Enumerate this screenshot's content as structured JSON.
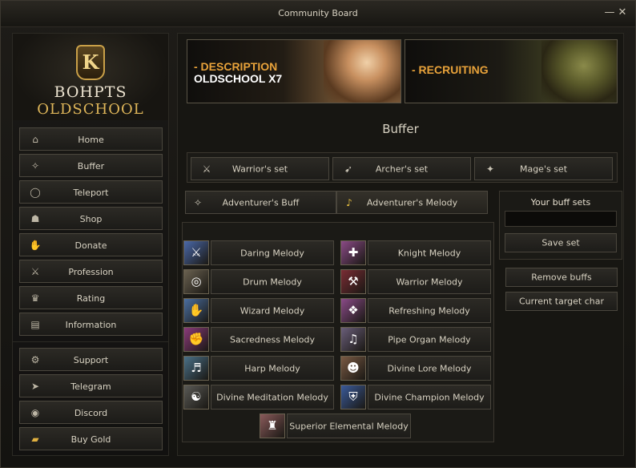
{
  "window": {
    "title": "Community Board",
    "minimize_glyph": "—",
    "close_glyph": "✕"
  },
  "logo": {
    "line1": "BOHPTS",
    "line2": "OLDSCHOOL",
    "mark": "K"
  },
  "sidebar": {
    "items": [
      {
        "label": "Home",
        "icon": "⌂"
      },
      {
        "label": "Buffer",
        "icon": "✧"
      },
      {
        "label": "Teleport",
        "icon": "◯"
      },
      {
        "label": "Shop",
        "icon": "☗"
      },
      {
        "label": "Donate",
        "icon": "✋"
      },
      {
        "label": "Profession",
        "icon": "⚔"
      },
      {
        "label": "Rating",
        "icon": "♛"
      },
      {
        "label": "Information",
        "icon": "▤"
      }
    ],
    "links": [
      {
        "label": "Support",
        "icon": "⚙"
      },
      {
        "label": "Telegram",
        "icon": "➤"
      },
      {
        "label": "Discord",
        "icon": "◉"
      },
      {
        "label": "Buy Gold",
        "icon": "▰"
      }
    ]
  },
  "banners": [
    {
      "accent": "- DESCRIPTION",
      "line2": "OLDSCHOOL X7"
    },
    {
      "accent": "- RECRUITING",
      "line2": ""
    }
  ],
  "section_title": "Buffer",
  "sets": [
    {
      "label": "Warrior's set",
      "icon": "⚔"
    },
    {
      "label": "Archer's set",
      "icon": "➹"
    },
    {
      "label": "Mage's set",
      "icon": "✦"
    }
  ],
  "buff_tabs": [
    {
      "label": "Adventurer's Buff",
      "icon": "✧"
    },
    {
      "label": "Adventurer's Melody",
      "icon": "♪"
    }
  ],
  "melodies": [
    {
      "label": "Daring Melody",
      "glyph": "⚔",
      "color": "#4a68a8"
    },
    {
      "label": "Knight Melody",
      "glyph": "✚",
      "color": "#8a4a86"
    },
    {
      "label": "Drum Melody",
      "glyph": "◎",
      "color": "#6a6150"
    },
    {
      "label": "Warrior Melody",
      "glyph": "⚒",
      "color": "#7a2c34"
    },
    {
      "label": "Wizard Melody",
      "glyph": "✋",
      "color": "#4a6ea0"
    },
    {
      "label": "Refreshing Melody",
      "glyph": "❖",
      "color": "#8a4a88"
    },
    {
      "label": "Sacredness Melody",
      "glyph": "✊",
      "color": "#8a3a7a"
    },
    {
      "label": "Pipe Organ Melody",
      "glyph": "♫",
      "color": "#6a5e7a"
    },
    {
      "label": "Harp Melody",
      "glyph": "♬",
      "color": "#4a7088"
    },
    {
      "label": "Divine Lore Melody",
      "glyph": "☻",
      "color": "#7a5a44"
    },
    {
      "label": "Divine Meditation Melody",
      "glyph": "☯",
      "color": "#5a5a56"
    },
    {
      "label": "Divine Champion Melody",
      "glyph": "⛨",
      "color": "#3a5a9a"
    },
    {
      "label": "Superior Elemental Melody",
      "glyph": "♜",
      "color": "#8a5a5a"
    }
  ],
  "buff_sets": {
    "title": "Your buff sets",
    "input_value": "",
    "save_label": "Save set"
  },
  "remove_buffs_label": "Remove buffs",
  "current_target_label": "Current target char"
}
